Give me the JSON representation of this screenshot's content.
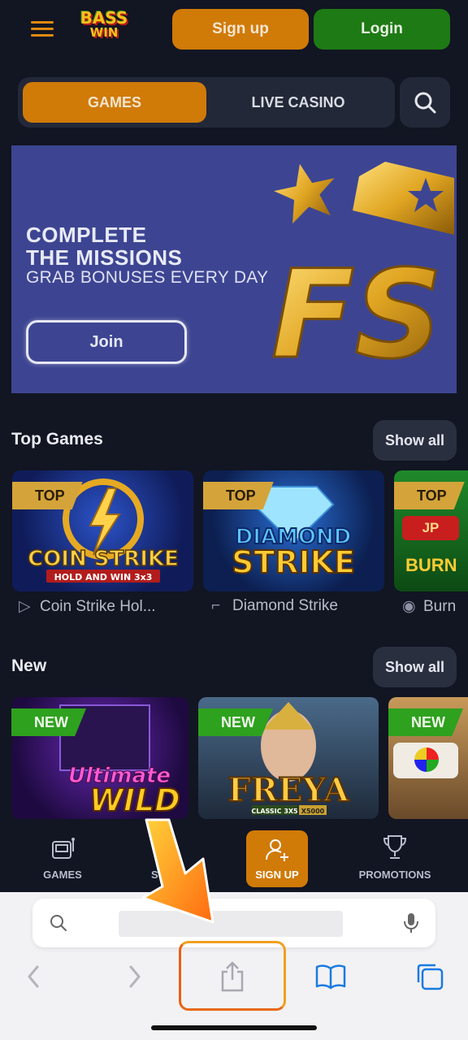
{
  "header": {
    "logo_line1": "BASS",
    "logo_line2": "WIN",
    "signup_label": "Sign up",
    "login_label": "Login"
  },
  "tabs": {
    "games": "GAMES",
    "live_casino": "LIVE CASINO"
  },
  "banner": {
    "line1": "COMPLETE",
    "line2": "THE MISSIONS",
    "subtitle": "GRAB BONUSES EVERY DAY",
    "join_label": "Join",
    "art_text": "FS"
  },
  "top_games": {
    "title": "Top Games",
    "show_all": "Show all",
    "cards": [
      {
        "badge": "TOP",
        "art_line1": "COIN STRIKE",
        "art_line2": "HOLD AND WIN 3x3",
        "name": "Coin Strike Hol..."
      },
      {
        "badge": "TOP",
        "art_line1": "DIAMOND",
        "art_line2": "STRIKE",
        "name": "Diamond Strike"
      },
      {
        "badge": "TOP",
        "extra_badge": "JP",
        "art_line1": "BURN",
        "name": "Burn"
      }
    ]
  },
  "new_games": {
    "title": "New",
    "show_all": "Show all",
    "cards": [
      {
        "badge": "NEW",
        "art_line1": "Ultimate",
        "art_line2": "WILD"
      },
      {
        "badge": "NEW",
        "art_line1": "FREYA",
        "art_line2": "CLASSIC 3X5",
        "art_line3": "X5000"
      },
      {
        "badge": "NEW"
      }
    ]
  },
  "bottom_nav": {
    "games": "GAMES",
    "sports": "S",
    "signup": "SIGN UP",
    "promotions": "PROMOTIONS"
  },
  "colors": {
    "background": "#121522",
    "accent_orange": "#d07a08",
    "accent_green": "#1e7a14",
    "banner_blue": "#3d4592"
  },
  "icons": [
    "menu-icon",
    "search-icon",
    "star-icon",
    "mic-icon",
    "share-icon",
    "bookmarks-icon",
    "tabs-icon",
    "back-icon",
    "forward-icon",
    "trophy-icon",
    "user-plus-icon",
    "slot-machine-icon"
  ]
}
